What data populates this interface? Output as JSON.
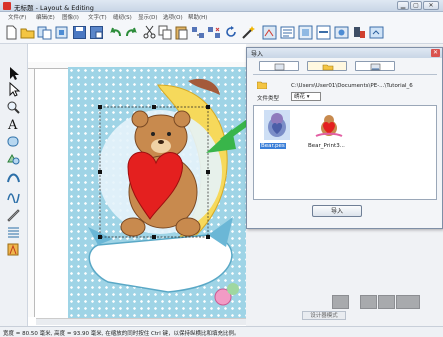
{
  "window": {
    "title": "无标题 - Layout & Editing",
    "buttons": [
      "▁",
      "▢",
      "✕"
    ]
  },
  "menu": [
    "文件(F)",
    "编辑(E)",
    "图像(I)",
    "文字(T)",
    "缝纫(S)",
    "显示(D)",
    "选项(O)",
    "帮助(H)"
  ],
  "dialog": {
    "title": "导入",
    "close": "✕",
    "path": "C:\\Users\\User01\\Documents\\PE-...\\Tutorial_6",
    "type_label": "文件类型",
    "type_value": "绣花 ▾",
    "files": [
      {
        "name": "Bear.pes",
        "selected": true
      },
      {
        "name": "Bear_Print3..."
      }
    ],
    "import_label": "导入"
  },
  "view_mode_label": "设计器模式",
  "status": "宽度 = 80.50 毫米, 高度 = 93.90 毫米, 在缩放的同时按住 Ctrl 键，以保持纵横比和填充比例。",
  "colors": {
    "accent_green": "#39b54a",
    "selection_blue": "#3b7fd8",
    "heart_red": "#e4201f"
  }
}
